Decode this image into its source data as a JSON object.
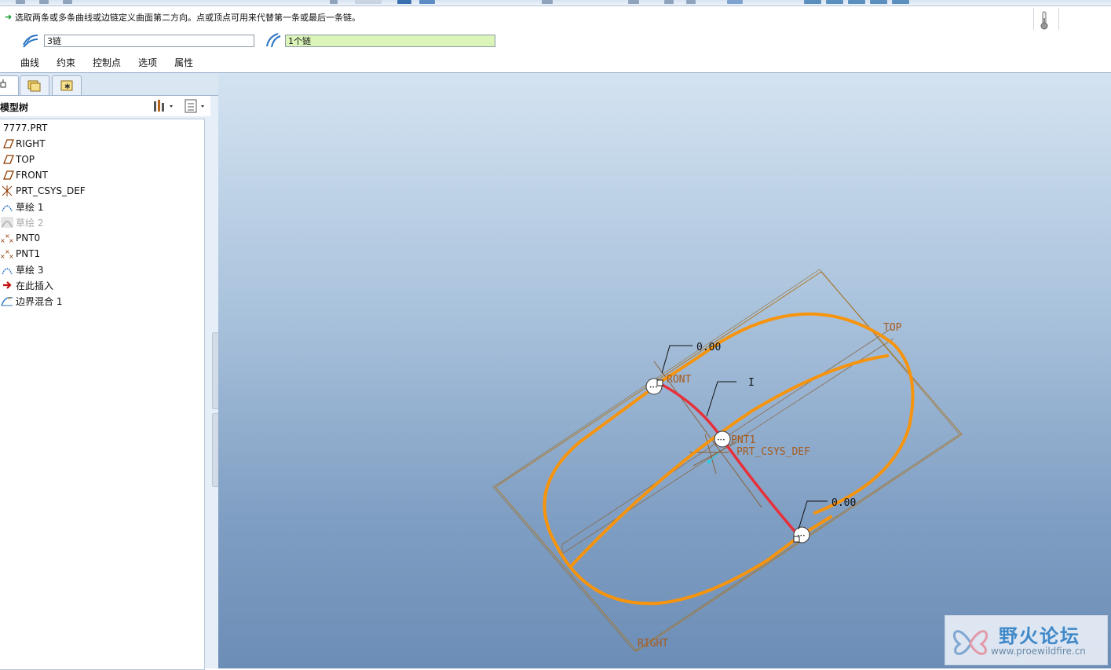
{
  "dashboard": {
    "message": "选取两条或多条曲线或边链定义曲面第二方向。点或顶点可用来代替第一条或最后一条链。",
    "first_direction_value": "3链",
    "second_direction_value": "1个链",
    "tabs": [
      "曲线",
      "约束",
      "控制点",
      "选项",
      "属性"
    ]
  },
  "model_tree": {
    "title": "模型树",
    "items": [
      {
        "label": "7777.PRT",
        "icon": "part-icon"
      },
      {
        "label": "RIGHT",
        "icon": "datum-plane-icon"
      },
      {
        "label": "TOP",
        "icon": "datum-plane-icon"
      },
      {
        "label": "FRONT",
        "icon": "datum-plane-icon"
      },
      {
        "label": "PRT_CSYS_DEF",
        "icon": "csys-icon"
      },
      {
        "label": "草绘 1",
        "icon": "sketch-icon"
      },
      {
        "label": "草绘 2",
        "icon": "sketch-hidden-icon"
      },
      {
        "label": "PNT0",
        "icon": "datum-point-icon"
      },
      {
        "label": "PNT1",
        "icon": "datum-point-icon"
      },
      {
        "label": "草绘 3",
        "icon": "sketch-icon"
      },
      {
        "label": "在此插入",
        "icon": "insert-here-icon"
      },
      {
        "label": "边界混合 1",
        "icon": "boundary-blend-icon"
      }
    ]
  },
  "viewport": {
    "labels": {
      "top": "TOP",
      "right": "RIGHT",
      "front": "RONT",
      "pnt1": "PNT1",
      "csys": "PRT_CSYS_DEF",
      "dim_top": "0.00",
      "dim_bottom": "0.00",
      "leader_1": "I"
    },
    "colors": {
      "curve": "#f7940d",
      "selected_chain": "#e8303a",
      "datum": "#b07a2a"
    }
  },
  "watermark": {
    "title": "野火论坛",
    "url": "www.proewildfire.cn"
  }
}
